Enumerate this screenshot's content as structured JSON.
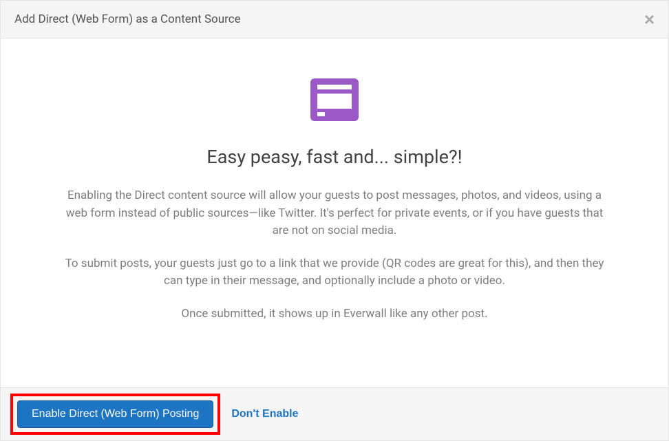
{
  "modal": {
    "title": "Add Direct (Web Form) as a Content Source",
    "icon": "web-form-icon",
    "headline": "Easy peasy, fast and... simple?!",
    "paragraphs": [
      "Enabling the Direct content source will allow your guests to post messages, photos, and videos, using a web form instead of public sources—like Twitter. It's perfect for private events, or if you have guests that are not on social media.",
      "To submit posts, your guests just go to a link that we provide (QR codes are great for this), and then they can type in their message, and optionally include a photo or video.",
      "Once submitted, it shows up in Everwall like any other post."
    ]
  },
  "footer": {
    "enable_label": "Enable Direct (Web Form) Posting",
    "dont_enable_label": "Don't Enable"
  },
  "colors": {
    "accent_purple": "#9a59c7",
    "primary_blue": "#1d74c3",
    "highlight_red": "#ff0000"
  }
}
